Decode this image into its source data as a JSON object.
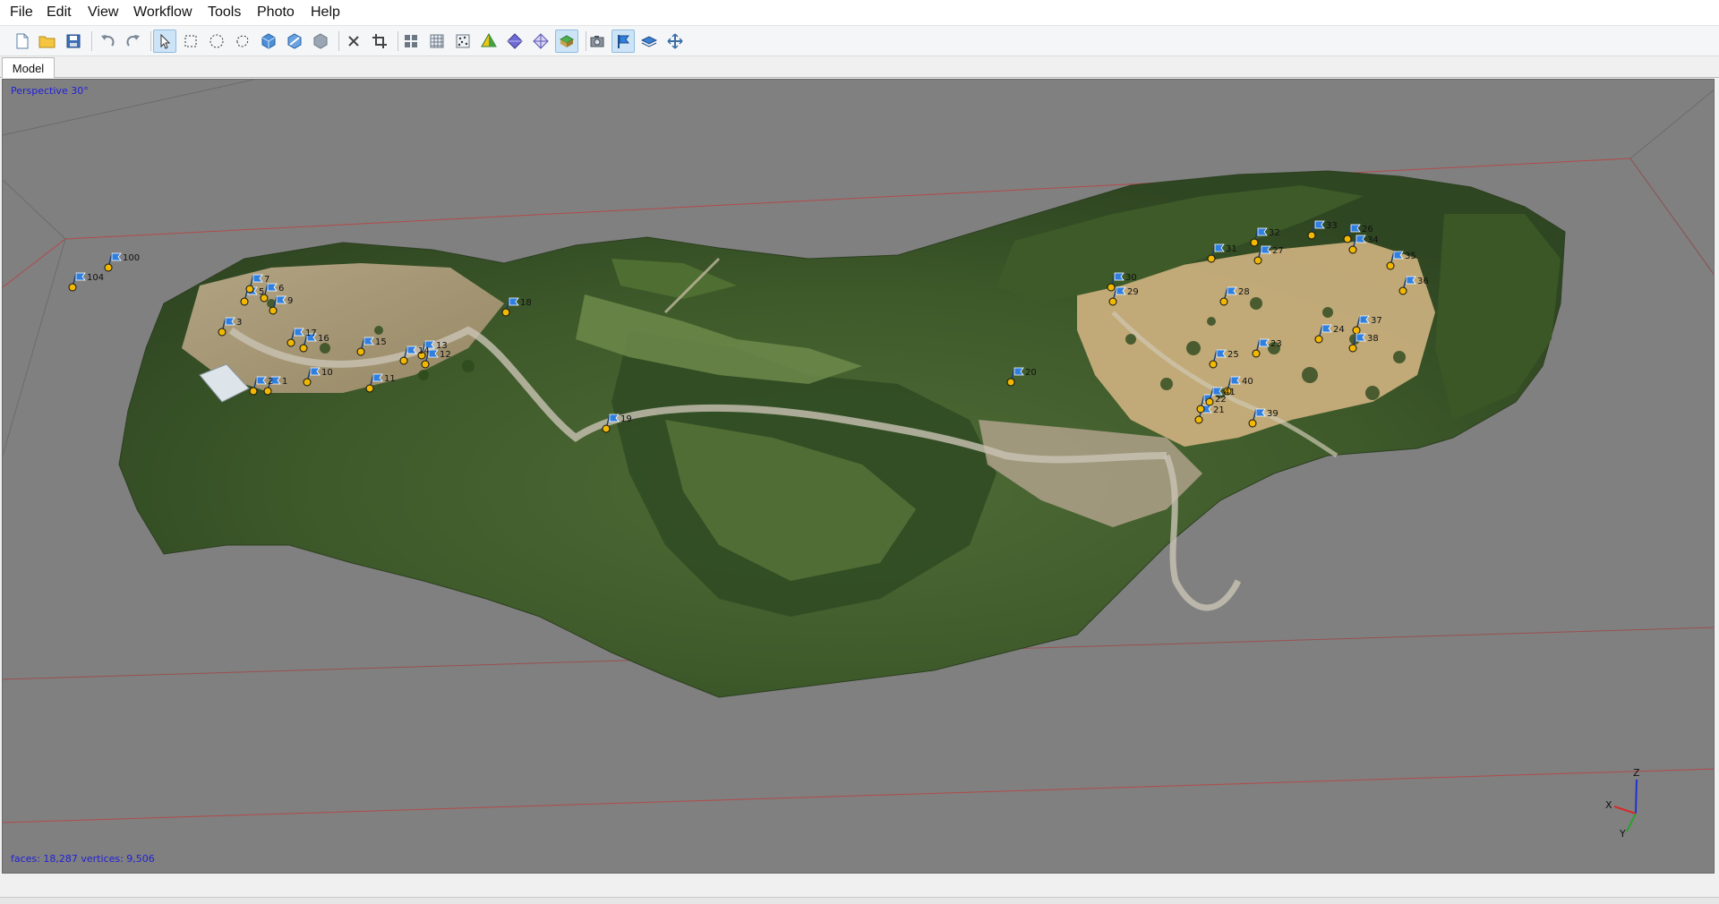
{
  "menu": {
    "file": "File",
    "edit": "Edit",
    "view": "View",
    "workflow": "Workflow",
    "tools": "Tools",
    "photo": "Photo",
    "help": "Help"
  },
  "toolbar": {
    "icons": [
      "new-document-icon",
      "open-folder-icon",
      "save-icon",
      "undo-icon",
      "redo-icon",
      "navigation-arrow-icon",
      "rectangle-selection-icon",
      "circle-selection-icon",
      "free-form-selection-icon",
      "select-by-color-icon",
      "grow-selection-icon",
      "reset-selection-icon",
      "delete-selection-icon",
      "crop-selection-icon",
      "show-cameras-icon",
      "show-grid-icon",
      "show-point-cloud-icon",
      "show-model-shaded-icon",
      "show-model-solid-icon",
      "show-model-wireframe-icon",
      "show-model-textured-icon",
      "show-cameras-toggle-icon",
      "show-markers-icon",
      "show-region-icon",
      "reset-view-icon"
    ],
    "active": [
      "navigation-arrow-icon",
      "show-model-textured-icon",
      "show-markers-icon"
    ]
  },
  "tabs": {
    "model": "Model"
  },
  "viewport": {
    "projection_label": "Perspective 30°",
    "stats_label": "faces: 18,287 vertices: 9,506",
    "axis_labels": {
      "x": "X",
      "y": "Y",
      "z": "Z"
    },
    "marker_labels": [
      "104",
      "100",
      "1",
      "2",
      "3",
      "5",
      "6",
      "7",
      "9",
      "10",
      "11",
      "12",
      "13",
      "14",
      "15",
      "16",
      "17",
      "18",
      "19",
      "20",
      "21",
      "22",
      "23",
      "24",
      "25",
      "26",
      "27",
      "28",
      "29",
      "30",
      "31",
      "32",
      "33",
      "34",
      "35",
      "36",
      "37",
      "38",
      "39",
      "40",
      "41"
    ]
  },
  "colors": {
    "viewport_bg": "#808080",
    "overlay_text": "#1f1fd8",
    "region_lines": "#b24a4a",
    "marker_flag": "#2f7fe0",
    "marker_point": "#f2b800"
  }
}
